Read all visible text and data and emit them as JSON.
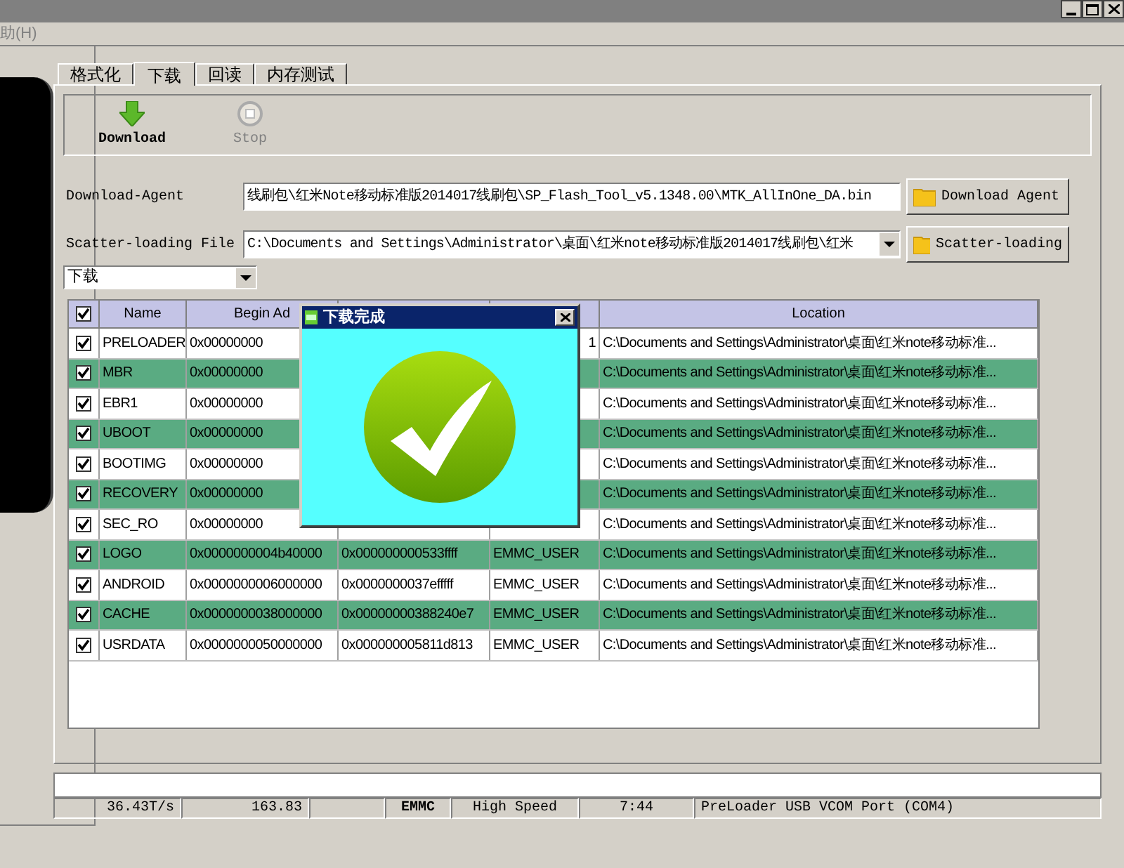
{
  "menu": [
    "助(H)"
  ],
  "tabs": [
    {
      "label": "格式化",
      "selected": false
    },
    {
      "label": "下载",
      "selected": true
    },
    {
      "label": "回读",
      "selected": false
    },
    {
      "label": "内存测试",
      "selected": false
    }
  ],
  "toolbar": [
    {
      "label": "Download",
      "disabled": false
    },
    {
      "label": "Stop",
      "disabled": true
    }
  ],
  "download_agent": {
    "label": "Download-Agent",
    "value": "线刷包\\红米Note移动标准版2014017线刷包\\SP_Flash_Tool_v5.1348.00\\MTK_AllInOne_DA.bin",
    "button": "Download Agent"
  },
  "scatter_loading": {
    "label": "Scatter-loading File",
    "value": "C:\\Documents and Settings\\Administrator\\桌面\\红米note移动标准版2014017线刷包\\红米",
    "button": "Scatter-loading"
  },
  "mode": {
    "value": "下载"
  },
  "table": {
    "header_checked": true,
    "columns": {
      "name": "Name",
      "begin": "Begin Ad",
      "location": "Location"
    },
    "rows": [
      {
        "checked": true,
        "name": "PRELOADER",
        "begin": "0x00000000",
        "region": "1",
        "location": "C:\\Documents and Settings\\Administrator\\桌面\\红米note移动标准..."
      },
      {
        "checked": true,
        "name": "MBR",
        "begin": "0x00000000",
        "location": "C:\\Documents and Settings\\Administrator\\桌面\\红米note移动标准..."
      },
      {
        "checked": true,
        "name": "EBR1",
        "begin": "0x00000000",
        "location": "C:\\Documents and Settings\\Administrator\\桌面\\红米note移动标准..."
      },
      {
        "checked": true,
        "name": "UBOOT",
        "begin": "0x00000000",
        "location": "C:\\Documents and Settings\\Administrator\\桌面\\红米note移动标准..."
      },
      {
        "checked": true,
        "name": "BOOTIMG",
        "begin": "0x00000000",
        "location": "C:\\Documents and Settings\\Administrator\\桌面\\红米note移动标准..."
      },
      {
        "checked": true,
        "name": "RECOVERY",
        "begin": "0x00000000",
        "location": "C:\\Documents and Settings\\Administrator\\桌面\\红米note移动标准..."
      },
      {
        "checked": true,
        "name": "SEC_RO",
        "begin": "0x00000000",
        "location": "C:\\Documents and Settings\\Administrator\\桌面\\红米note移动标准..."
      },
      {
        "checked": true,
        "name": "LOGO",
        "begin": "0x0000000004b40000",
        "end": "0x000000000533ffff",
        "region": "EMMC_USER",
        "location": "C:\\Documents and Settings\\Administrator\\桌面\\红米note移动标准..."
      },
      {
        "checked": true,
        "name": "ANDROID",
        "begin": "0x0000000006000000",
        "end": "0x0000000037efffff",
        "region": "EMMC_USER",
        "location": "C:\\Documents and Settings\\Administrator\\桌面\\红米note移动标准..."
      },
      {
        "checked": true,
        "name": "CACHE",
        "begin": "0x0000000038000000",
        "end": "0x00000000388240e7",
        "region": "EMMC_USER",
        "location": "C:\\Documents and Settings\\Administrator\\桌面\\红米note移动标准..."
      },
      {
        "checked": true,
        "name": "USRDATA",
        "begin": "0x0000000050000000",
        "end": "0x000000005811d813",
        "region": "EMMC_USER",
        "location": "C:\\Documents and Settings\\Administrator\\桌面\\红米note移动标准..."
      }
    ]
  },
  "dialog": {
    "title": "下载完成"
  },
  "progress": {
    "level": 0
  },
  "status_bar": [
    {
      "text": "36.43T/s"
    },
    {
      "text": "163.83"
    },
    {
      "kind": "empty"
    },
    {
      "text": "EMMC",
      "kind": "bold"
    },
    {
      "text": "High Speed"
    },
    {
      "text": "7:44"
    },
    {
      "text": "PreLoader USB VCOM Port (COM4)"
    }
  ]
}
